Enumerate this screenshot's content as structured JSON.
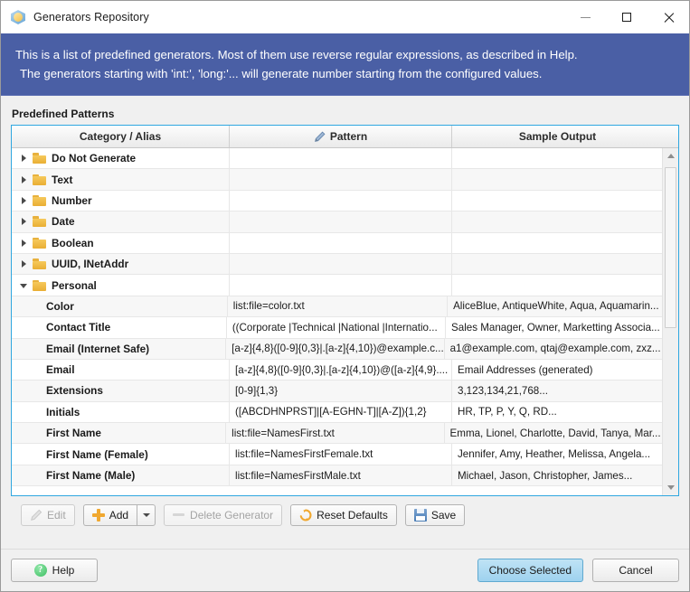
{
  "window": {
    "title": "Generators Repository",
    "icon": "app-hex-icon",
    "controls": {
      "minimize": "–",
      "maximize": "□",
      "close": "✕"
    }
  },
  "banner": {
    "line1": "This is a list of predefined generators. Most of them use reverse regular expressions, as described in Help.",
    "line2": "The generators starting with 'int:', 'long:'... will generate number starting from the configured values.",
    "background": "#4a5fa5",
    "text_color": "#ffffff"
  },
  "section": {
    "label": "Predefined Patterns"
  },
  "table": {
    "columns": [
      "Category / Alias",
      "Pattern",
      "Sample Output"
    ],
    "pattern_header_icon": "pencil-icon",
    "rows": [
      {
        "type": "group",
        "expanded": false,
        "name": "Do Not Generate",
        "pattern": "",
        "sample": ""
      },
      {
        "type": "group",
        "expanded": false,
        "name": "Text",
        "pattern": "",
        "sample": ""
      },
      {
        "type": "group",
        "expanded": false,
        "name": "Number",
        "pattern": "",
        "sample": ""
      },
      {
        "type": "group",
        "expanded": false,
        "name": "Date",
        "pattern": "",
        "sample": ""
      },
      {
        "type": "group",
        "expanded": false,
        "name": "Boolean",
        "pattern": "",
        "sample": ""
      },
      {
        "type": "group",
        "expanded": false,
        "name": "UUID, INetAddr",
        "pattern": "",
        "sample": ""
      },
      {
        "type": "group",
        "expanded": true,
        "name": "Personal",
        "pattern": "",
        "sample": ""
      },
      {
        "type": "leaf",
        "name": "Color",
        "pattern": "list:file=color.txt",
        "sample": "AliceBlue, AntiqueWhite, Aqua, Aquamarin..."
      },
      {
        "type": "leaf",
        "name": "Contact Title",
        "pattern": "((Corporate |Technical |National |Internatio...",
        "sample": "Sales Manager, Owner, Marketting Associa..."
      },
      {
        "type": "leaf",
        "name": "Email (Internet Safe)",
        "pattern": "[a-z]{4,8}([0-9]{0,3}|.[a-z]{4,10})@example.c...",
        "sample": "a1@example.com, qtaj@example.com, zxz..."
      },
      {
        "type": "leaf",
        "name": "Email",
        "pattern": "[a-z]{4,8}([0-9]{0,3}|.[a-z]{4,10})@([a-z]{4,9}....",
        "sample": "Email Addresses (generated)"
      },
      {
        "type": "leaf",
        "name": "Extensions",
        "pattern": "[0-9]{1,3}",
        "sample": "3,123,134,21,768..."
      },
      {
        "type": "leaf",
        "name": "Initials",
        "pattern": "([ABCDHNPRST]|[A-EGHN-T]|[A-Z]){1,2}",
        "sample": "HR, TP, P, Y, Q, RD..."
      },
      {
        "type": "leaf",
        "name": "First Name",
        "pattern": "list:file=NamesFirst.txt",
        "sample": "Emma, Lionel, Charlotte, David, Tanya, Mar..."
      },
      {
        "type": "leaf",
        "name": "First Name (Female)",
        "pattern": "list:file=NamesFirstFemale.txt",
        "sample": "Jennifer, Amy, Heather, Melissa, Angela..."
      },
      {
        "type": "leaf",
        "name": "First Name (Male)",
        "pattern": "list:file=NamesFirstMale.txt",
        "sample": "Michael, Jason, Christopher, James..."
      }
    ],
    "border_color": "#2fa7e0"
  },
  "toolbar": {
    "edit": {
      "label": "Edit",
      "icon": "pencil-icon",
      "enabled": false
    },
    "add": {
      "label": "Add",
      "icon": "plus-icon",
      "enabled": true,
      "has_dropdown": true,
      "dropdown_icon": "chevron-down-icon"
    },
    "delete": {
      "label": "Delete Generator",
      "icon": "minus-icon",
      "enabled": false
    },
    "reset": {
      "label": "Reset Defaults",
      "icon": "refresh-icon",
      "enabled": true
    },
    "save": {
      "label": "Save",
      "icon": "floppy-disk-icon",
      "enabled": true
    }
  },
  "footer": {
    "help": {
      "label": "Help",
      "icon": "help-circle-icon"
    },
    "choose": {
      "label": "Choose Selected",
      "primary": true
    },
    "cancel": {
      "label": "Cancel"
    }
  }
}
